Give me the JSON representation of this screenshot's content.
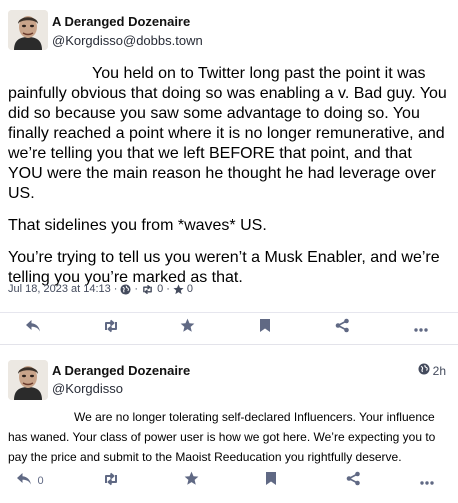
{
  "posts": [
    {
      "author": {
        "display_name": "A Deranged Dozenaire",
        "handle": "@Korgdisso@dobbs.town"
      },
      "paragraphs": [
        "You held on to Twitter long past the point it was painfully obvious that doing so was enabling a v. Bad guy. You did so because you saw some advantage to doing so. You finally reached a point where it is no longer remunerative, and we’re telling you that we left BEFORE that point, and that YOU were the main reason he thought he had leverage over US.",
        "That sidelines you from *waves* US.",
        "You’re trying to tell us you weren’t a Musk Enabler, and we’re telling you you’re marked as that."
      ],
      "meta": {
        "timestamp": "Jul 18, 2023 at 14:13",
        "visibility_icon": "globe-icon",
        "boost_count": "0",
        "favourite_count": "0"
      },
      "actions": [
        "reply",
        "boost",
        "favourite",
        "bookmark",
        "share",
        "more"
      ]
    },
    {
      "author": {
        "display_name": "A Deranged Dozenaire",
        "handle": "@Korgdisso"
      },
      "relative_time": "2h",
      "text": "We are no longer tolerating self-declared Influencers. Your influence has waned. Your class of power user is how we got here. We’re expecting you to pay the price and submit to the Maoist Reeducation you rightfully deserve.",
      "reply_count": "0",
      "actions": [
        "reply",
        "boost",
        "favourite",
        "bookmark",
        "share",
        "more"
      ]
    }
  ],
  "colors": {
    "icon": "#606984",
    "muted_text": "#444b5d",
    "divider": "#e3e3ea"
  }
}
